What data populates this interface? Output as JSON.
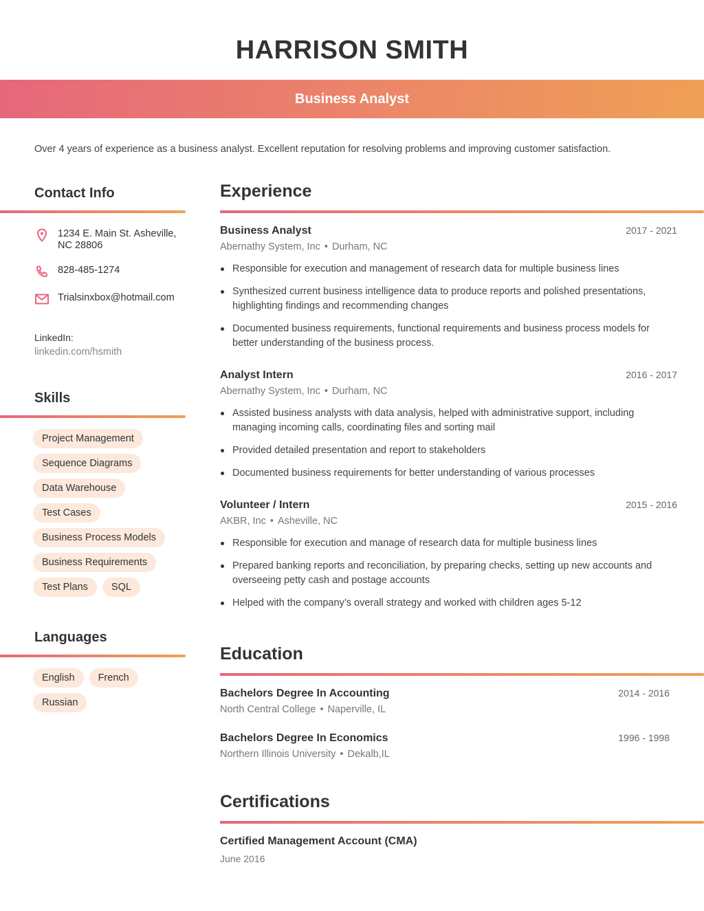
{
  "header": {
    "name": "HARRISON SMITH",
    "role": "Business Analyst"
  },
  "summary": "Over 4 years of experience as a business analyst. Excellent reputation for resolving problems and improving customer satisfaction.",
  "theme": {
    "accent_start": "#e6677b",
    "accent_end": "#f0a055",
    "chip_bg": "#fce9dc"
  },
  "contact": {
    "title": "Contact Info",
    "address": "1234 E. Main St. Asheville, NC 28806",
    "phone": "828-485-1274",
    "email": "Trialsinxbox@hotmail.com",
    "linkedin_label": "LinkedIn:",
    "linkedin_url": "linkedin.com/hsmith",
    "icons": [
      "map-pin-icon",
      "phone-icon",
      "mail-icon"
    ]
  },
  "skills": {
    "title": "Skills",
    "items": [
      "Project Management",
      "Sequence Diagrams",
      "Data Warehouse",
      "Test Cases",
      "Business Process Models",
      "Business Requirements",
      "Test Plans",
      "SQL"
    ]
  },
  "languages": {
    "title": "Languages",
    "items": [
      "English",
      "French",
      "Russian"
    ]
  },
  "experience": {
    "title": "Experience",
    "jobs": [
      {
        "title": "Business Analyst",
        "dates": "2017 - 2021",
        "company": "Abernathy System, Inc",
        "location": "Durham, NC",
        "bullets": [
          "Responsible for execution and management of research data for multiple business lines",
          "Synthesized current business intelligence data to produce reports and polished presentations, highlighting findings and recommending changes",
          "Documented business requirements, functional requirements and business process models for better understanding of the business process."
        ]
      },
      {
        "title": "Analyst Intern",
        "dates": "2016 - 2017",
        "company": "Abernathy System, Inc",
        "location": "Durham, NC",
        "bullets": [
          "Assisted business analysts with data analysis, helped with administrative support, including managing incoming calls, coordinating files and sorting mail",
          "Provided detailed presentation and report to stakeholders",
          "Documented business requirements for better understanding of various processes"
        ]
      },
      {
        "title": "Volunteer / Intern",
        "dates": "2015 - 2016",
        "company": "AKBR, Inc",
        "location": "Asheville, NC",
        "bullets": [
          "Responsible for execution and manage of research data for multiple business lines",
          "Prepared banking reports and reconciliation, by preparing checks, setting up new accounts and overseeing petty cash and postage accounts",
          "Helped with the company’s overall strategy and worked with children ages 5-12"
        ]
      }
    ]
  },
  "education": {
    "title": "Education",
    "items": [
      {
        "degree": "Bachelors Degree In Accounting",
        "dates": "2014 - 2016",
        "school": "North Central College",
        "location": "Naperville, IL"
      },
      {
        "degree": "Bachelors Degree In Economics",
        "dates": "1996 - 1998",
        "school": "Northern Illinois University",
        "location": "Dekalb,IL"
      }
    ]
  },
  "certifications": {
    "title": "Certifications",
    "items": [
      {
        "name": "Certified Management Account (CMA)",
        "date": "June 2016"
      }
    ]
  },
  "separator": "•"
}
